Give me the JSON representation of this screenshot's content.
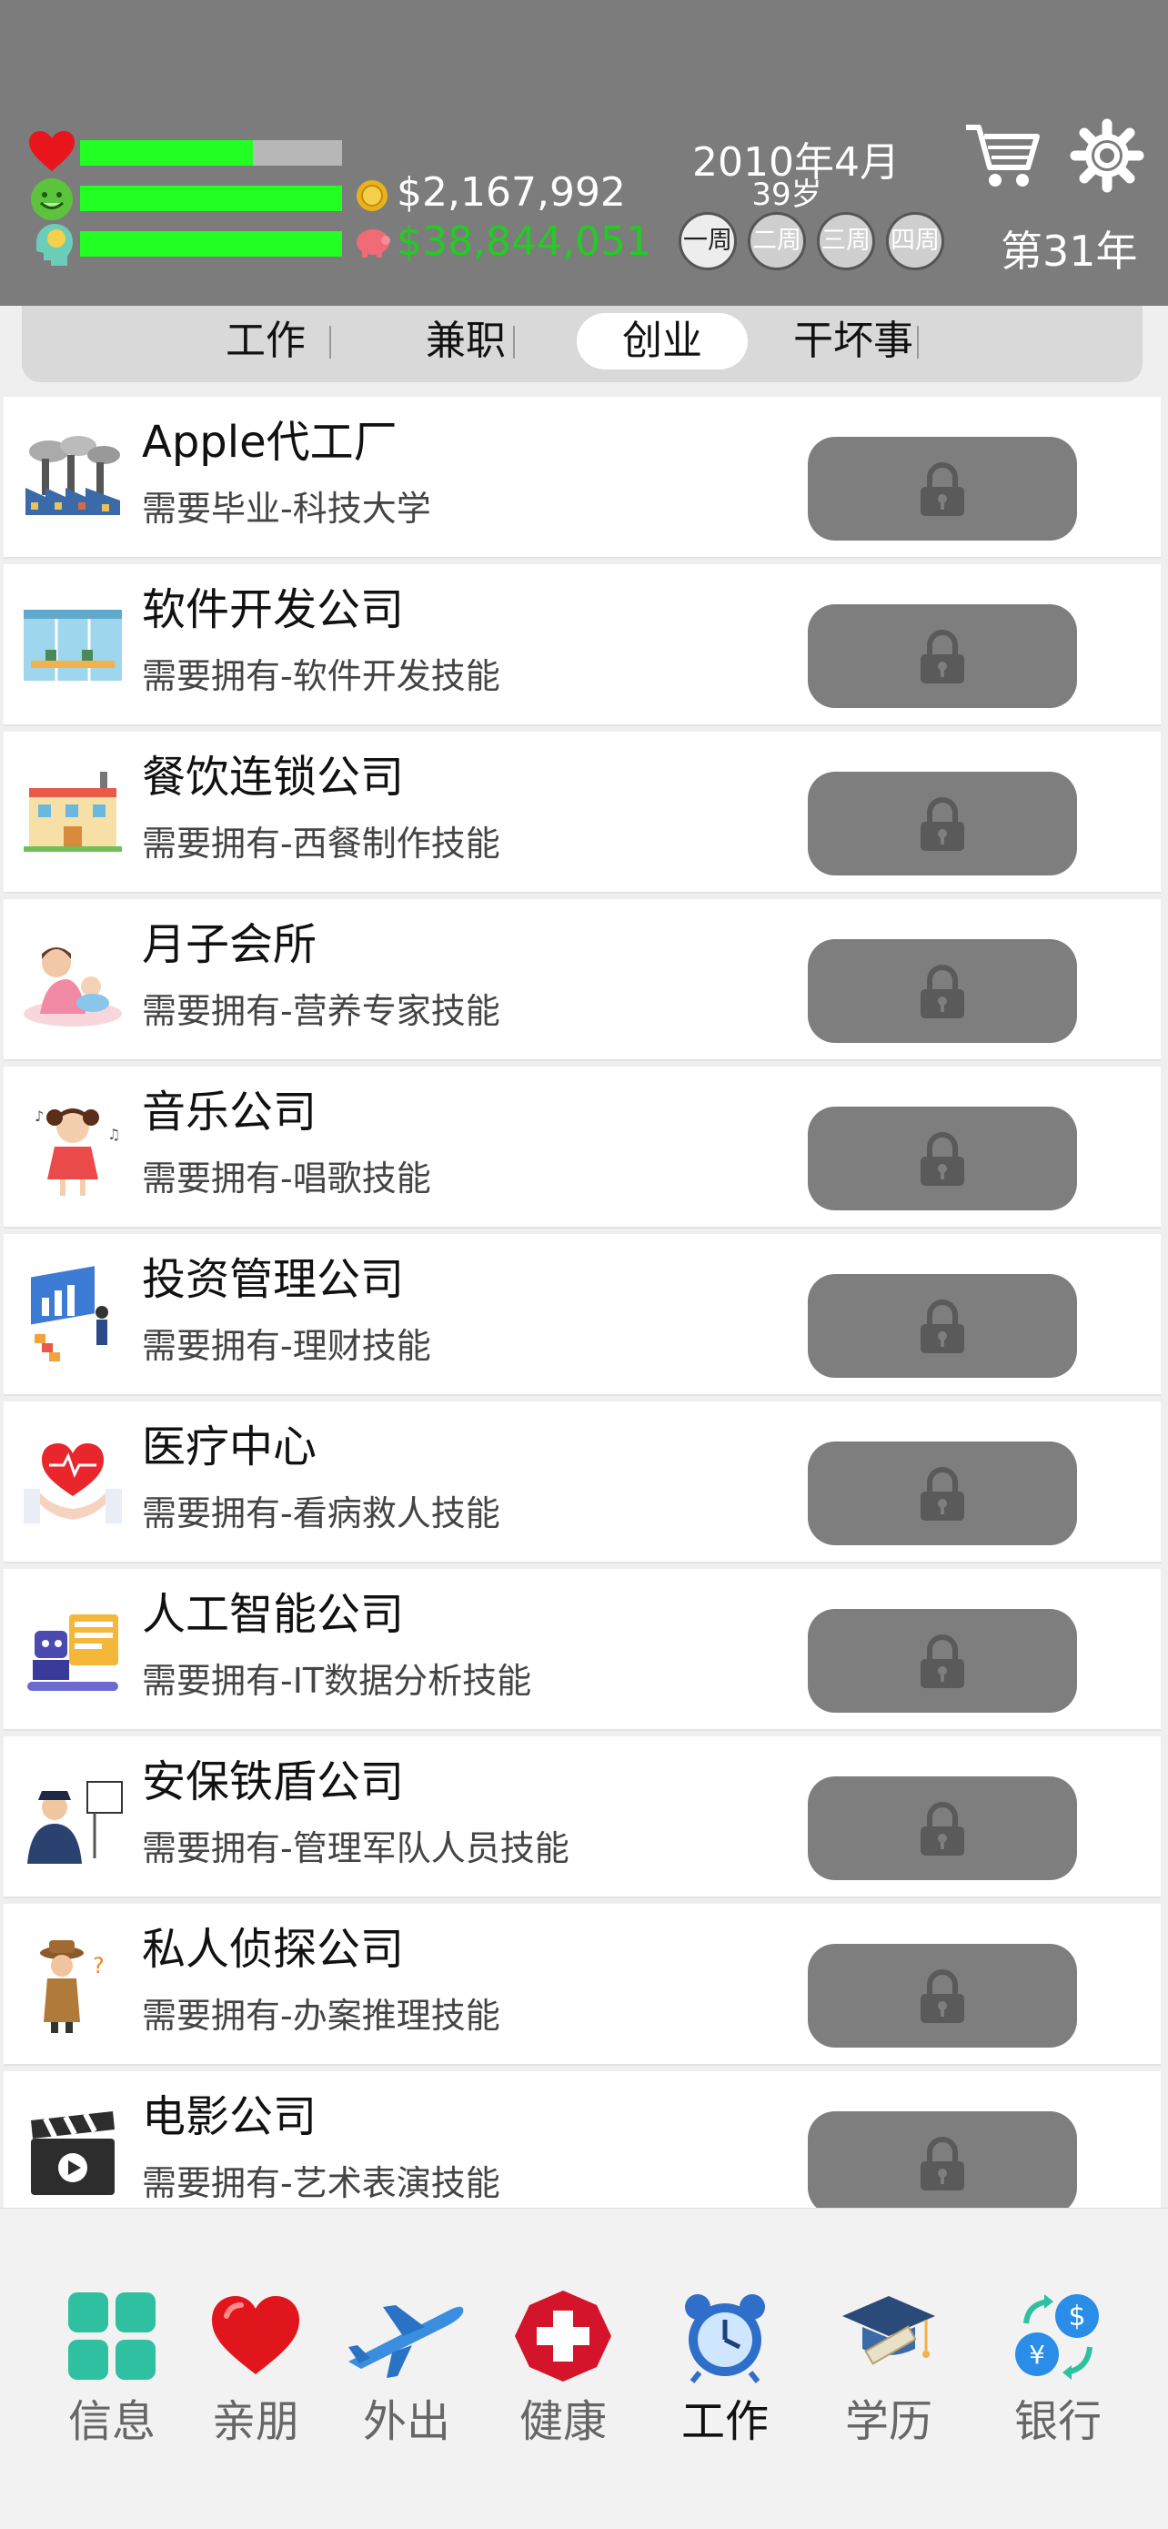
{
  "header": {
    "money": "$2,167,992",
    "savings": "$38,844,051",
    "date": "2010年4月",
    "age": "39岁",
    "weeks": [
      "一周",
      "二周",
      "三周",
      "四周"
    ],
    "active_week": 0,
    "year": "第31年",
    "stats": {
      "health": 0.66,
      "happiness": 1.0,
      "intellect": 1.0
    },
    "icons": [
      "heart-icon",
      "happy-face-icon",
      "brain-head-icon",
      "coin-icon",
      "piggy-bank-icon",
      "shopping-cart-icon",
      "gear-icon"
    ],
    "colors": {
      "bar_fill": "#22ff22",
      "savings_text": "#22cc22",
      "money_text": "#ffffff",
      "header_bg": "#7c7c7c"
    }
  },
  "tabs": [
    {
      "label": "工作",
      "active": false
    },
    {
      "label": "兼职",
      "active": false
    },
    {
      "label": "创业",
      "active": true
    },
    {
      "label": "干坏事",
      "active": false
    }
  ],
  "businesses": [
    {
      "title": "Apple代工厂",
      "requirement": "需要毕业-科技大学",
      "icon": "factory-icon",
      "locked": true
    },
    {
      "title": "软件开发公司",
      "requirement": "需要拥有-软件开发技能",
      "icon": "office-icon",
      "locked": true
    },
    {
      "title": "餐饮连锁公司",
      "requirement": "需要拥有-西餐制作技能",
      "icon": "restaurant-building-icon",
      "locked": true
    },
    {
      "title": "月子会所",
      "requirement": "需要拥有-营养专家技能",
      "icon": "mother-baby-icon",
      "locked": true
    },
    {
      "title": "音乐公司",
      "requirement": "需要拥有-唱歌技能",
      "icon": "singing-girl-icon",
      "locked": true
    },
    {
      "title": "投资管理公司",
      "requirement": "需要拥有-理财技能",
      "icon": "investment-chart-icon",
      "locked": true
    },
    {
      "title": "医疗中心",
      "requirement": "需要拥有-看病救人技能",
      "icon": "heart-hands-icon",
      "locked": true
    },
    {
      "title": "人工智能公司",
      "requirement": "需要拥有-IT数据分析技能",
      "icon": "robot-icon",
      "locked": true
    },
    {
      "title": "安保铁盾公司",
      "requirement": "需要拥有-管理军队人员技能",
      "icon": "security-guard-icon",
      "locked": true
    },
    {
      "title": "私人侦探公司",
      "requirement": "需要拥有-办案推理技能",
      "icon": "detective-icon",
      "locked": true
    },
    {
      "title": "电影公司",
      "requirement": "需要拥有-艺术表演技能",
      "icon": "clapperboard-icon",
      "locked": true
    }
  ],
  "nav": [
    {
      "label": "信息",
      "icon": "info-grid-icon",
      "active": false
    },
    {
      "label": "亲朋",
      "icon": "heart-icon",
      "active": false
    },
    {
      "label": "外出",
      "icon": "airplane-icon",
      "active": false
    },
    {
      "label": "健康",
      "icon": "medical-cross-icon",
      "active": false
    },
    {
      "label": "工作",
      "icon": "alarm-clock-icon",
      "active": true
    },
    {
      "label": "学历",
      "icon": "graduation-cap-icon",
      "active": false
    },
    {
      "label": "银行",
      "icon": "currency-exchange-icon",
      "active": false
    }
  ]
}
